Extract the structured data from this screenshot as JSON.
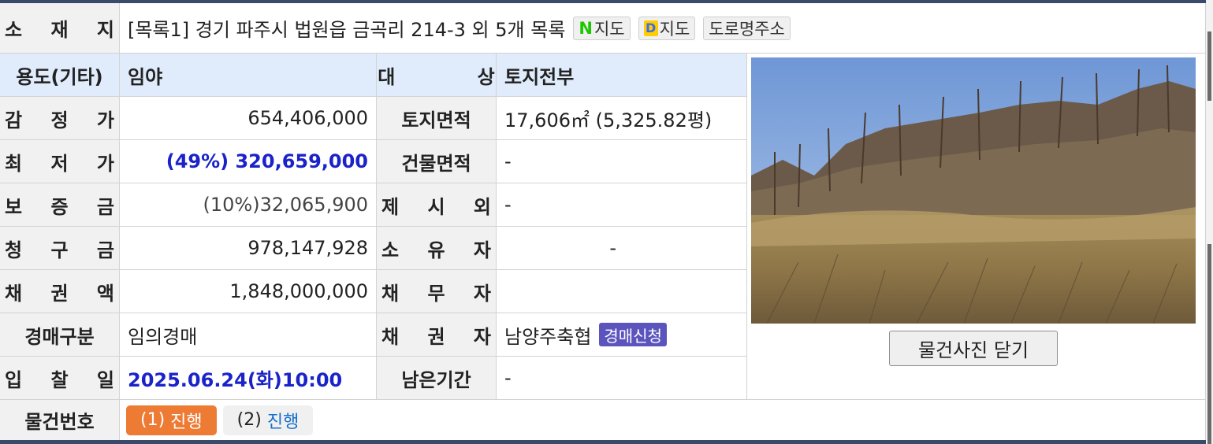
{
  "address": {
    "label": "소 재 지",
    "text": "[목록1] 경기 파주시 법원읍 금곡리 214-3 외 5개 목록",
    "naver_map": {
      "mark": "N",
      "label": "지도"
    },
    "daum_map": {
      "mark": "D",
      "label": "지도"
    },
    "road_address": "도로명주소"
  },
  "rows": {
    "use": {
      "label": "용도(기타)",
      "value": "임야"
    },
    "target": {
      "label": "대      상",
      "value": "토지전부"
    },
    "appraisal": {
      "label": "감 정 가",
      "value": "654,406,000"
    },
    "land_area": {
      "label": "토지면적",
      "value": "17,606㎡ (5,325.82평)"
    },
    "min_price": {
      "label": "최 저 가",
      "value": "(49%) 320,659,000"
    },
    "building_area": {
      "label": "건물면적",
      "value": "-"
    },
    "deposit": {
      "label": "보 증 금",
      "value": "(10%)32,065,900"
    },
    "excluded": {
      "label": "제 시 외",
      "value": "-"
    },
    "claim": {
      "label": "청 구 금",
      "value": "978,147,928"
    },
    "owner": {
      "label": "소 유 자",
      "value": "-"
    },
    "credit": {
      "label": "채 권 액",
      "value": "1,848,000,000"
    },
    "debtor": {
      "label": "채 무 자",
      "value": ""
    },
    "auction_type": {
      "label": "경매구분",
      "value": "임의경매"
    },
    "creditor": {
      "label": "채 권 자",
      "value": "남양주축협",
      "badge": "경매신청"
    },
    "bid_date": {
      "label": "입 찰 일",
      "value": "2025.06.24(화)10:00"
    },
    "remaining": {
      "label": "남은기간",
      "value": "-"
    }
  },
  "items": {
    "label": "물건번호",
    "list": [
      {
        "num": "(1)",
        "status": "진행",
        "active": true
      },
      {
        "num": "(2)",
        "status": "진행",
        "active": false
      }
    ]
  },
  "photo": {
    "close_button": "물건사진 닫기"
  },
  "colors": {
    "label_bg": "#f1f1f1",
    "highlight_bg": "#e0ecfb",
    "accent_blue": "#1a23c9",
    "orange": "#ed7b34",
    "badge": "#5b54bd"
  }
}
